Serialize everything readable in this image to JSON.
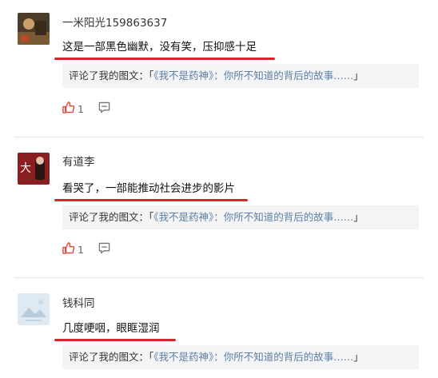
{
  "comments": [
    {
      "username": "一米阳光159863637",
      "text": "这是一部黑色幽默，没有笑，压抑感十足",
      "quote_prefix": "评论了我的图文：「",
      "quote_title": "《我不是药神》：你所不知道的背后的故事……",
      "quote_suffix": "」",
      "likes": "1",
      "avatar": "photo-avatar"
    },
    {
      "username": "有道李",
      "text": "看哭了，一部能推动社会进步的影片",
      "quote_prefix": "评论了我的图文：「",
      "quote_title": "《我不是药神》：你所不知道的背后的故事……",
      "quote_suffix": "」",
      "likes": "1",
      "avatar": "poster-avatar"
    },
    {
      "username": "钱科同",
      "text": "几度哽咽，眼眶湿润",
      "quote_prefix": "评论了我的图文：「",
      "quote_title": "《我不是药神》：你所不知道的背后的故事……",
      "quote_suffix": "」",
      "avatar": "default-avatar"
    }
  ],
  "colors": {
    "accent": "#d6262c",
    "link": "#5b7fa8",
    "quote_bg": "#f4f4f4"
  }
}
